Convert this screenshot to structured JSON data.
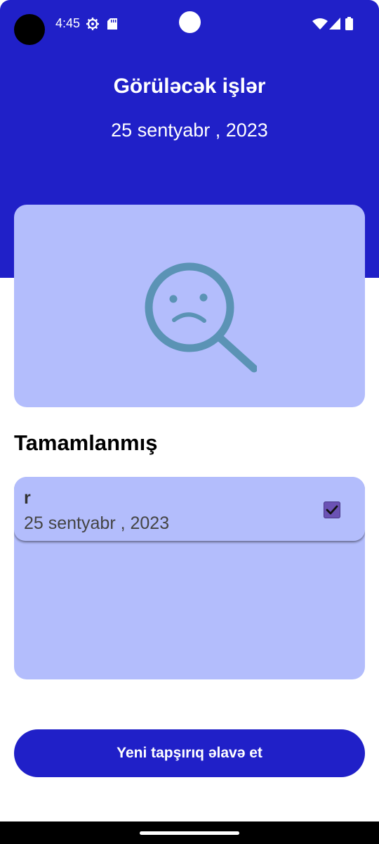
{
  "status_bar": {
    "time": "4:45",
    "icons": [
      "gear-icon",
      "sd-card-icon",
      "wifi-icon",
      "signal-icon",
      "battery-icon"
    ]
  },
  "header": {
    "title": "Görüləcək işlər",
    "date": "25 sentyabr , 2023"
  },
  "empty_state": {
    "icon": "sad-search-icon"
  },
  "completed": {
    "title": "Tamamlanmış",
    "items": [
      {
        "name": "r",
        "date": "25 sentyabr , 2023",
        "checked": true
      }
    ]
  },
  "add_button": {
    "label": "Yeni tapşırıq əlavə et"
  },
  "colors": {
    "primary": "#2020c8",
    "card": "#b3bdfc",
    "icon": "#5b93b5",
    "checkbox": "#6b52b4"
  }
}
